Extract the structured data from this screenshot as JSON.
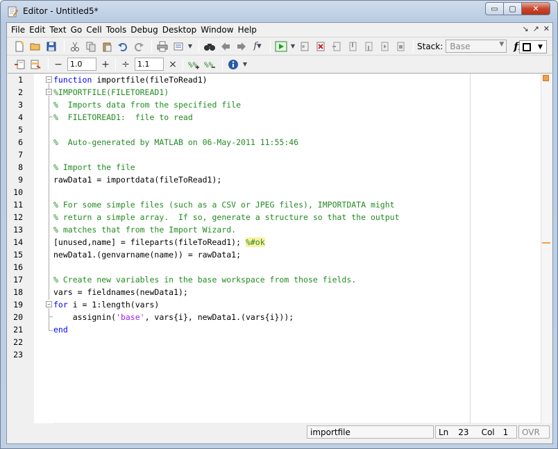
{
  "window": {
    "title": "Editor - Untitled5*",
    "controls": {
      "minimize": "▭",
      "maximize": "▢",
      "close": "✕"
    }
  },
  "menubar": {
    "items": [
      "File",
      "Edit",
      "Text",
      "Go",
      "Cell",
      "Tools",
      "Debug",
      "Desktop",
      "Window",
      "Help"
    ],
    "right_icons": [
      "↘",
      "↗",
      "✕"
    ]
  },
  "toolbar": {
    "stack_label": "Stack:",
    "stack_value": "Base",
    "fx_label": "fx"
  },
  "cell_toolbar": {
    "decrement": "−",
    "increment": "+",
    "divide": "÷",
    "multiply": "×",
    "value_1": "1.0",
    "value_2": "1.1"
  },
  "code": {
    "line_numbers": [
      "1",
      "2",
      "3",
      "4",
      "5",
      "6",
      "7",
      "8",
      "9",
      "10",
      "11",
      "12",
      "13",
      "14",
      "15",
      "16",
      "17",
      "18",
      "19",
      "20",
      "21",
      "22",
      "23"
    ],
    "l1_kw": "function",
    "l1_rest": " importfile(fileToRead1)",
    "l2": "%IMPORTFILE(FILETOREAD1)",
    "l3": "%  Imports data from the specified file",
    "l4": "%  FILETOREAD1:  file to read",
    "l6": "%  Auto-generated by MATLAB on 06-May-2011 11:55:46",
    "l8": "% Import the file",
    "l9": "rawData1 = importdata(fileToRead1);",
    "l11": "% For some simple files (such as a CSV or JPEG files), IMPORTDATA might",
    "l12": "% return a simple array.  If so, generate a structure so that the output",
    "l13": "% matches that from the Import Wizard.",
    "l14_code": "[unused,name] = fileparts(fileToRead1); ",
    "l14_comment": "%#ok",
    "l15": "newData1.(genvarname(name)) = rawData1;",
    "l17": "% Create new variables in the base workspace from those fields.",
    "l18": "vars = fieldnames(newData1);",
    "l19_kw": "for",
    "l19_rest": " i = 1:length(vars)",
    "l20_a": "    assignin(",
    "l20_str": "'base'",
    "l20_b": ", vars{i}, newData1.(vars{i}));",
    "l21_kw": "end"
  },
  "status": {
    "function_name": "importfile",
    "ln_label": "Ln",
    "ln_value": "23",
    "col_label": "Col",
    "col_value": "1",
    "ovr": "OVR"
  }
}
